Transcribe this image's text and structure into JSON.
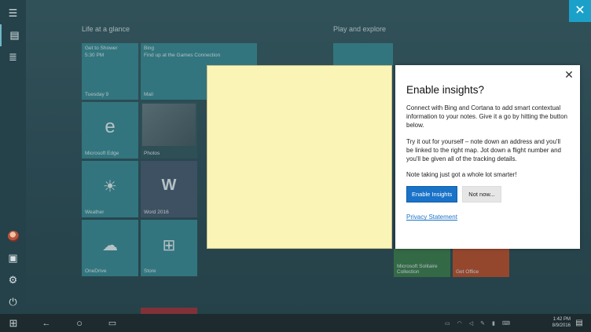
{
  "window": {
    "close_glyph": "✕"
  },
  "rail": {
    "items": [
      {
        "name": "hamburger-menu-icon",
        "glyph": "☰"
      },
      {
        "name": "all-notes-icon",
        "glyph": "▤"
      },
      {
        "name": "list-view-icon",
        "glyph": "≣"
      }
    ],
    "bottom": [
      {
        "name": "photos-icon",
        "glyph": "▣"
      },
      {
        "name": "settings-gear-icon",
        "glyph": "⚙"
      },
      {
        "name": "power-icon",
        "glyph": "⏻"
      }
    ]
  },
  "sections": {
    "life": "Life at a glance",
    "play": "Play and explore"
  },
  "tiles": {
    "calendar": {
      "top": "Get to Shower",
      "sub": "5:30 PM",
      "label": "Tuesday 9"
    },
    "mail": {
      "top": "Bing",
      "sub": "Find up at the Games Connection",
      "label": "Mail"
    },
    "edge": {
      "label": "Microsoft Edge",
      "glyph": "e"
    },
    "photos": {
      "label": "Photos"
    },
    "weather": {
      "label": "Weather",
      "glyph": "☀"
    },
    "word": {
      "label": "Word 2016",
      "glyph": "W"
    },
    "onedrive": {
      "label": "OneDrive",
      "glyph": "☁"
    },
    "store": {
      "label": "Store",
      "glyph": "⊞"
    },
    "solitaire": {
      "label": "Microsoft Solitaire Collection"
    },
    "office": {
      "label": "Get Office"
    }
  },
  "dialog": {
    "title": "Enable insights?",
    "para1": "Connect with Bing and Cortana to add smart contextual information to your notes. Give it a go by hitting the button below.",
    "para2": "Try it out for yourself – note down an address and you'll be linked to the right map. Jot down a flight number and you'll be given all of the tracking details.",
    "para3": "Note taking just got a whole lot smarter!",
    "enable_label": "Enable Insights",
    "notnow_label": "Not now...",
    "privacy_label": "Privacy Statement",
    "close_glyph": "✕"
  },
  "taskbar": {
    "start_glyph": "⊞",
    "back_glyph": "←",
    "cortana_glyph": "○",
    "taskview_glyph": "▭",
    "time": "1:42 PM",
    "date": "8/9/2016",
    "notification_glyph": "▤"
  },
  "colors": {
    "accent": "#1a73c8",
    "note": "#fbf4b7",
    "tile": "#3b8f99"
  }
}
